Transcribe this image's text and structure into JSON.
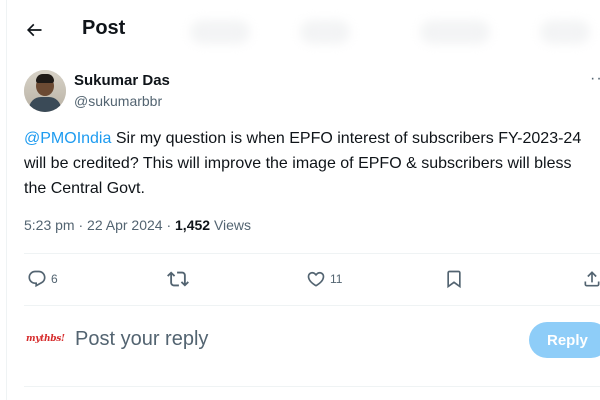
{
  "header": {
    "title": "Post"
  },
  "post": {
    "author": {
      "display_name": "Sukumar Das",
      "handle": "@sukumarbbr"
    },
    "more_label": "···",
    "text": {
      "mention": "@PMOIndia",
      "body": " Sir my question is when EPFO interest of subscribers FY-2023-24 will be credited? This will improve the image of EPFO & subscribers will bless the Central Govt."
    },
    "meta": {
      "time": "5:23 pm",
      "separator": " · ",
      "date": "22 Apr 2024",
      "views_count": "1,452",
      "views_label": " Views"
    },
    "actions": {
      "reply_count": "6",
      "like_count": "11",
      "icons": [
        "reply-icon",
        "retweet-icon",
        "like-icon",
        "bookmark-icon",
        "share-icon"
      ]
    }
  },
  "reply": {
    "logo_text": "mythbs!",
    "placeholder": "Post your reply",
    "button_label": "Reply"
  },
  "colors": {
    "accent": "#1d9bf0",
    "reply_button_disabled": "#8ecdf8",
    "text_primary": "#0f1419",
    "text_secondary": "#536471",
    "divider": "#eff3f4"
  }
}
